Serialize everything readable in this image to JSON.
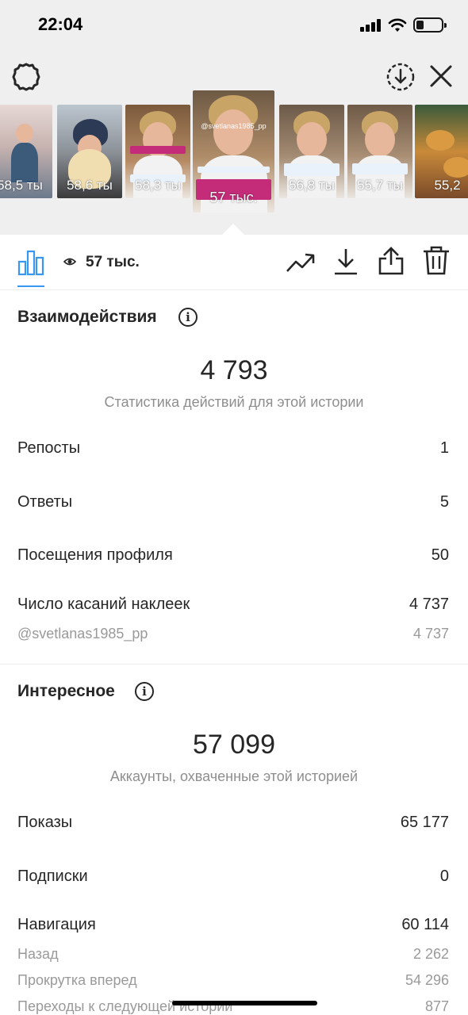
{
  "status_bar": {
    "time": "22:04"
  },
  "thumbnails": [
    {
      "views": "58,5 ты"
    },
    {
      "views": "58,6 ты"
    },
    {
      "views": "58,3 ты"
    },
    {
      "views": "57 тыс.",
      "handle": "@svetlanas1985_pp"
    },
    {
      "views": "56,8 ты"
    },
    {
      "views": "55,7 ты"
    },
    {
      "views": "55,2"
    }
  ],
  "toolbar": {
    "views_label": "57 тыс."
  },
  "interactions": {
    "title": "Взаимодействия",
    "total": "4 793",
    "subtitle": "Статистика действий для этой истории",
    "rows": [
      {
        "label": "Репосты",
        "value": "1"
      },
      {
        "label": "Ответы",
        "value": "5"
      },
      {
        "label": "Посещения профиля",
        "value": "50"
      },
      {
        "label": "Число касаний наклеек",
        "value": "4 737"
      }
    ],
    "sticker_sub": {
      "label": "@svetlanas1985_pp",
      "value": "4 737"
    }
  },
  "discovery": {
    "title": "Интересное",
    "total": "57 099",
    "subtitle": "Аккаунты, охваченные этой историей",
    "rows": [
      {
        "label": "Показы",
        "value": "65 177"
      },
      {
        "label": "Подписки",
        "value": "0"
      },
      {
        "label": "Навигация",
        "value": "60 114"
      }
    ],
    "nav_sub": [
      {
        "label": "Назад",
        "value": "2 262"
      },
      {
        "label": "Прокрутка вперед",
        "value": "54 296"
      },
      {
        "label": "Переходы к следующей истории",
        "value": "877"
      }
    ]
  },
  "colors": {
    "accent": "#3897f0",
    "muted": "#8e8e8e",
    "top_bg": "#efefef",
    "tag_pink": "#c42c7a"
  }
}
